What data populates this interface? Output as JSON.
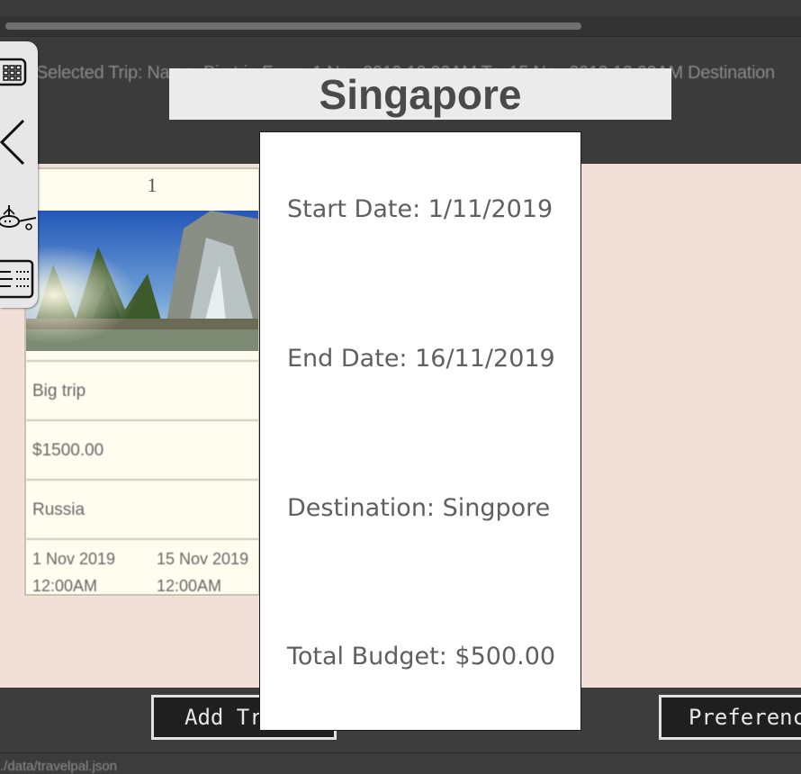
{
  "status_bar": {
    "text": "Selected Trip: Name: Big trip From: 1 Nov 2019 12:00AM To: 15 Nov 2019 12:00AM Destination"
  },
  "popup": {
    "title": "Singapore",
    "start_date": "Start Date: 1/11/2019",
    "end_date": "End Date: 16/11/2019",
    "destination": "Destination: Singpore",
    "total_budget": "Total Budget: $500.00"
  },
  "trip_card": {
    "index": "1",
    "name": "Big trip",
    "budget": "$1500.00",
    "destination": "Russia",
    "start_date": "1 Nov 2019",
    "start_time": "12:00AM",
    "end_date": "15 Nov 2019",
    "end_time": "12:00AM"
  },
  "sidebar": {
    "icons": [
      "calendar-icon",
      "back-arrow-icon",
      "airplane-icon",
      "itinerary-list-icon"
    ]
  },
  "buttons": {
    "add_trip": "Add Trip",
    "preferences": "Preferences"
  },
  "footer": {
    "path": "./data/travelpal.json"
  },
  "colors": {
    "background_dark": "#3b3b3b",
    "content_bg": "#f1dfd8",
    "card_bg": "#fffdf0",
    "popup_bg": "#ffffff",
    "title_banner_bg": "#ebebeb"
  }
}
